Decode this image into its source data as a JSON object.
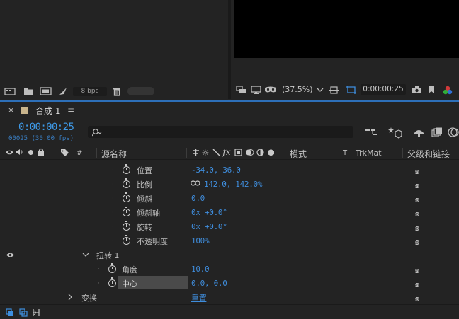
{
  "project_panel": {
    "bpc": "8 bpc"
  },
  "viewer": {
    "zoom": "(37.5%)",
    "timecode": "0:00:00:25"
  },
  "timeline": {
    "tab_label": "合成 1",
    "tab_menu": "≡",
    "current_time": "0:00:00:25",
    "frame_info": "00025 (30.00 fps)",
    "search_placeholder": "",
    "columns": {
      "hash": "#",
      "source_name": "源名称",
      "mode": "模式",
      "t": "T",
      "trkmat": "TrkMat",
      "parent": "父级和链接"
    },
    "transform_props": [
      {
        "name": "位置",
        "value": "-34.0, 36.0"
      },
      {
        "name": "比例",
        "value": "142.0, 142.0%"
      },
      {
        "name": "倾斜",
        "value": "0.0"
      },
      {
        "name": "倾斜轴",
        "value": "0x +0.0°"
      },
      {
        "name": "旋转",
        "value": "0x +0.0°"
      },
      {
        "name": "不透明度",
        "value": "100%"
      }
    ],
    "effect_name": "扭转 1",
    "effect_props": [
      {
        "name": "角度",
        "value": "10.0"
      },
      {
        "name": "中心",
        "value": "0.0, 0.0"
      }
    ],
    "transform_group": {
      "name": "变换",
      "value": "重置"
    }
  }
}
